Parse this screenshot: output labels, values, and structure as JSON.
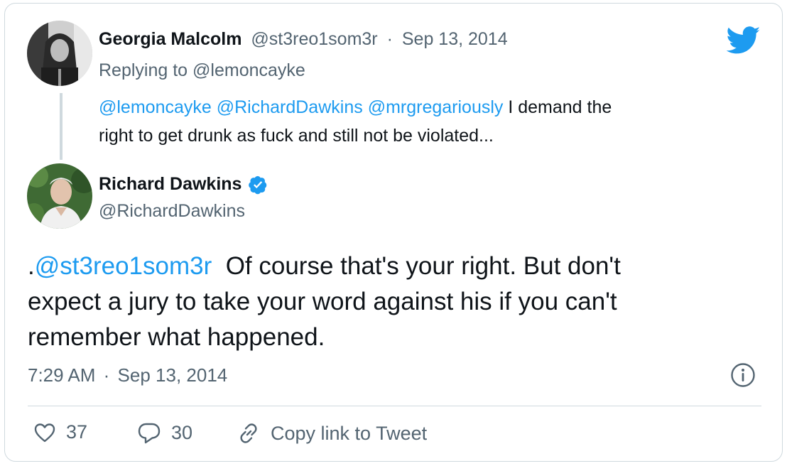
{
  "reply": {
    "author_name": "Georgia Malcolm",
    "author_handle": "@st3reo1som3r",
    "separator": "·",
    "date": "Sep 13, 2014",
    "replying_to_prefix": "Replying to ",
    "replying_to_handle": "@lemoncayke",
    "mentions": [
      "@lemoncayke",
      "@RichardDawkins",
      "@mrgregariously"
    ],
    "text_line1_rest": " I demand the",
    "text_line2": "right to get drunk as fuck and still not be violated..."
  },
  "tweet": {
    "author_name": "Richard Dawkins",
    "author_handle": "@RichardDawkins",
    "verified": true,
    "text_prefix": ".",
    "text_mention": "@st3reo1som3r",
    "text_line1_rest": "  Of course that's your right. But don't",
    "text_line2": "expect a jury to take your word against his if you can't",
    "text_line3": "remember what happened.",
    "time": "7:29 AM",
    "separator": "·",
    "date": "Sep 13, 2014"
  },
  "actions": {
    "likes": "37",
    "replies": "30",
    "copy_link_label": "Copy link to Tweet"
  },
  "icons": {
    "brand": "twitter-bird-icon",
    "info": "info-icon",
    "like": "heart-icon",
    "reply": "reply-bubble-icon",
    "link": "link-chain-icon",
    "verified": "verified-badge-icon"
  },
  "colors": {
    "brand_blue": "#1d9bf0",
    "text": "#0f1419",
    "muted": "#536471",
    "border": "#cfd9de"
  }
}
